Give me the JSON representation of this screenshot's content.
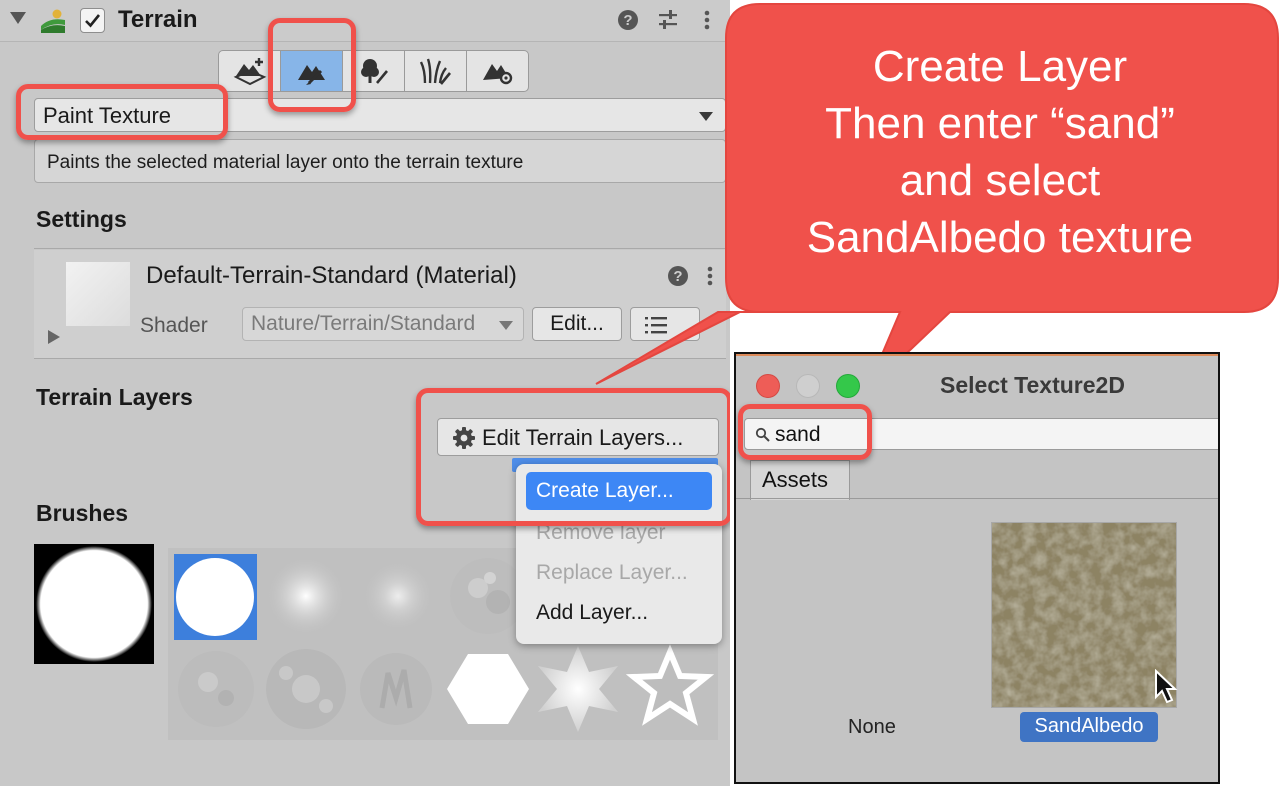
{
  "inspector": {
    "component_title": "Terrain",
    "component_enabled": true,
    "toolbar": {
      "tools": [
        "create-neighbor-terrains",
        "paint-terrain",
        "paint-trees",
        "paint-details",
        "terrain-settings"
      ],
      "active_tool": "paint-terrain"
    },
    "mode_dropdown": {
      "value": "Paint Texture"
    },
    "help_text": "Paints the selected material layer onto the terrain texture",
    "settings": {
      "title": "Settings",
      "material_title": "Default-Terrain-Standard (Material)",
      "shader_label": "Shader",
      "shader_value": "Nature/Terrain/Standard",
      "edit_button": "Edit..."
    },
    "terrain_layers": {
      "title": "Terrain Layers",
      "edit_button": "Edit Terrain Layers...",
      "menu": {
        "items": [
          "Create Layer...",
          "Remove layer",
          "Replace Layer...",
          "Add Layer..."
        ],
        "highlighted": "Create Layer...",
        "disabled": [
          "Remove layer",
          "Replace Layer..."
        ]
      }
    },
    "brushes": {
      "title": "Brushes"
    }
  },
  "picker": {
    "title": "Select Texture2D",
    "search_value": "sand",
    "tab": "Assets",
    "items": [
      {
        "label": "None"
      },
      {
        "label": "SandAlbedo",
        "selected": true
      }
    ]
  },
  "callout": {
    "lines": [
      "Create Layer",
      "Then enter “sand”",
      "and select",
      "SandAlbedo texture"
    ]
  },
  "colors": {
    "callout": "#f0514b",
    "selection": "#3d87f5",
    "active_tool": "#87b5e8"
  }
}
